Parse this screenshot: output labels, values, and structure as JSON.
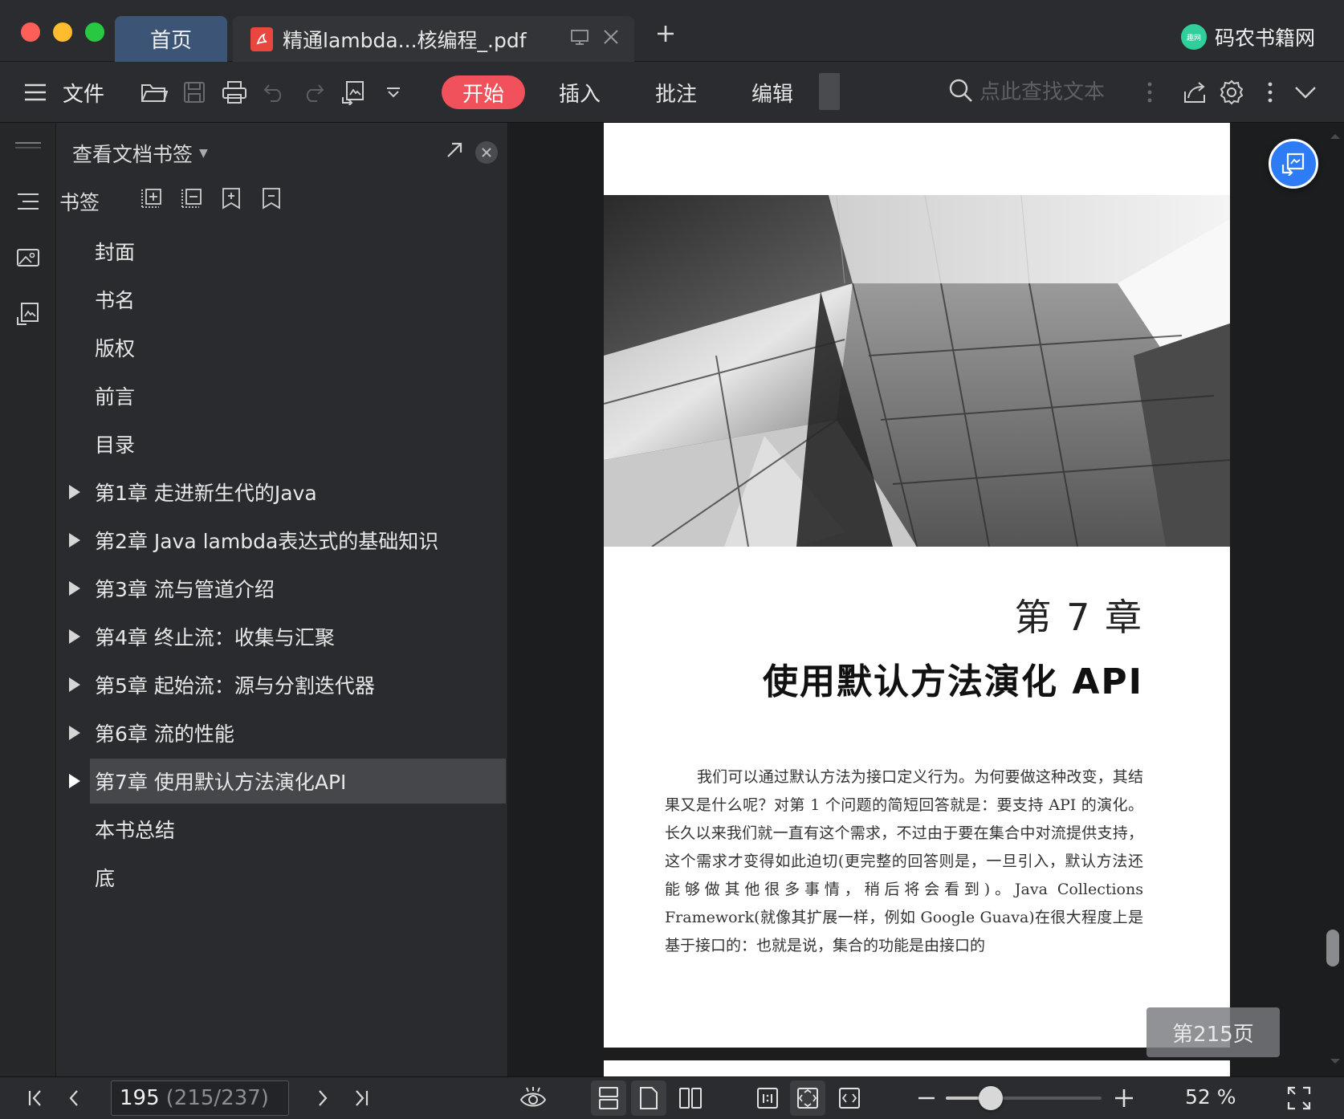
{
  "titlebar": {
    "home_tab": "首页",
    "doc_tab": "精通lambda...核编程_.pdf",
    "brand_logo_text": "趣网",
    "brand": "码农书籍网"
  },
  "toolbar": {
    "file_label": "文件",
    "tabs": [
      "开始",
      "插入",
      "批注",
      "编辑"
    ],
    "search_placeholder": "点此查找文本"
  },
  "panel": {
    "title": "查看文档书签",
    "bookmark_label": "书签",
    "items": [
      {
        "label": "封面",
        "expandable": false,
        "selected": false
      },
      {
        "label": "书名",
        "expandable": false,
        "selected": false
      },
      {
        "label": "版权",
        "expandable": false,
        "selected": false
      },
      {
        "label": "前言",
        "expandable": false,
        "selected": false
      },
      {
        "label": "目录",
        "expandable": false,
        "selected": false
      },
      {
        "label": "第1章  走进新生代的Java",
        "expandable": true,
        "selected": false
      },
      {
        "label": "第2章  Java lambda表达式的基础知识",
        "expandable": true,
        "selected": false
      },
      {
        "label": "第3章  流与管道介绍",
        "expandable": true,
        "selected": false
      },
      {
        "label": "第4章  终止流：收集与汇聚",
        "expandable": true,
        "selected": false
      },
      {
        "label": "第5章  起始流：源与分割迭代器",
        "expandable": true,
        "selected": false
      },
      {
        "label": "第6章  流的性能",
        "expandable": true,
        "selected": false
      },
      {
        "label": "第7章  使用默认方法演化API",
        "expandable": true,
        "selected": true
      },
      {
        "label": "本书总结",
        "expandable": false,
        "selected": false
      },
      {
        "label": "底",
        "expandable": false,
        "selected": false
      }
    ]
  },
  "document": {
    "chapter_number": "第 7 章",
    "chapter_title": "使用默认方法演化 API",
    "body": "我们可以通过默认方法为接口定义行为。为何要做这种改变，其结果又是什么呢？对第 1 个问题的简短回答就是：要支持 API 的演化。长久以来我们就一直有这个需求，不过由于要在集合中对流提供支持，这个需求才变得如此迫切(更完整的回答则是，一旦引入，默认方法还能够做其他很多事情，稍后将会看到)。Java Collections Framework(就像其扩展一样，例如 Google Guava)在很大程度上是基于接口的：也就是说，集合的功能是由接口的",
    "page_badge": "第215页"
  },
  "statusbar": {
    "page_current": "195",
    "page_total": "(215/237)",
    "zoom_value": "52 %",
    "zoom_level": 0.29
  },
  "colors": {
    "accent": "#f0515a",
    "home_tab": "#3c5577",
    "float_button": "#2d7cf6",
    "brand_logo": "#2fcf9b"
  }
}
